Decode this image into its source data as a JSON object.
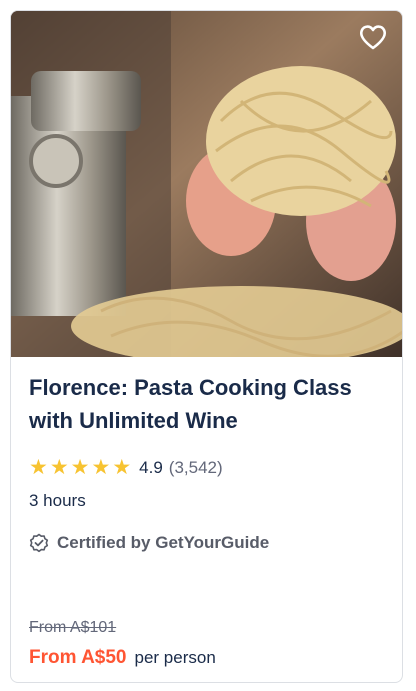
{
  "card": {
    "title": "Florence: Pasta Cooking Class with Unlimited Wine",
    "rating": {
      "score": "4.9",
      "count": "(3,542)",
      "stars": 5
    },
    "duration": "3 hours",
    "certified": "Certified by GetYourGuide",
    "price_original": "From A$101",
    "price_current": "From A$50",
    "price_unit": "per person",
    "icons": {
      "wishlist": "heart-icon",
      "certified": "badge-check-icon",
      "star": "star-icon"
    },
    "colors": {
      "title": "#1a2b49",
      "star": "#f7c331",
      "price": "#ff5533"
    }
  }
}
